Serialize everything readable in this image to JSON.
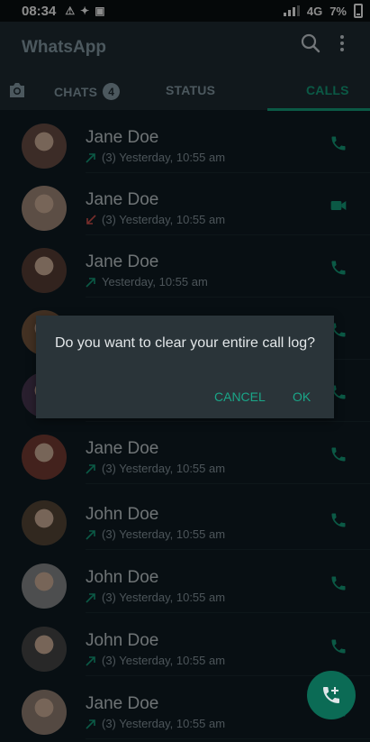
{
  "status_bar": {
    "time": "08:34",
    "network": "4G",
    "battery": "7%"
  },
  "app": {
    "title": "WhatsApp",
    "tabs": {
      "chats": "CHATS",
      "chats_badge": "4",
      "status": "STATUS",
      "calls": "CALLS"
    }
  },
  "calls": [
    {
      "name": "Jane Doe",
      "detail": "(3) Yesterday, 10:55 am",
      "direction": "outgoing",
      "type": "voice"
    },
    {
      "name": "Jane Doe",
      "detail": "(3) Yesterday, 10:55 am",
      "direction": "missed",
      "type": "video"
    },
    {
      "name": "Jane Doe",
      "detail": "Yesterday, 10:55 am",
      "direction": "outgoing",
      "type": "voice"
    },
    {
      "name": "",
      "detail": "",
      "direction": "outgoing",
      "type": "voice"
    },
    {
      "name": "",
      "detail": "",
      "direction": "outgoing",
      "type": "voice"
    },
    {
      "name": "Jane Doe",
      "detail": "(3) Yesterday, 10:55 am",
      "direction": "outgoing",
      "type": "voice"
    },
    {
      "name": "John Doe",
      "detail": "(3) Yesterday, 10:55 am",
      "direction": "outgoing",
      "type": "voice"
    },
    {
      "name": "John Doe",
      "detail": "(3) Yesterday, 10:55 am",
      "direction": "outgoing",
      "type": "voice"
    },
    {
      "name": "John Doe",
      "detail": "(3) Yesterday, 10:55 am",
      "direction": "outgoing",
      "type": "voice"
    },
    {
      "name": "Jane Doe",
      "detail": "(3) Yesterday, 10:55 am",
      "direction": "outgoing",
      "type": "voice"
    }
  ],
  "dialog": {
    "message": "Do you want to clear your entire call log?",
    "cancel": "CANCEL",
    "ok": "OK"
  },
  "colors": {
    "accent": "#14a37f",
    "missed": "#d9534f",
    "header": "#1f2c34",
    "background": "#101d24"
  }
}
